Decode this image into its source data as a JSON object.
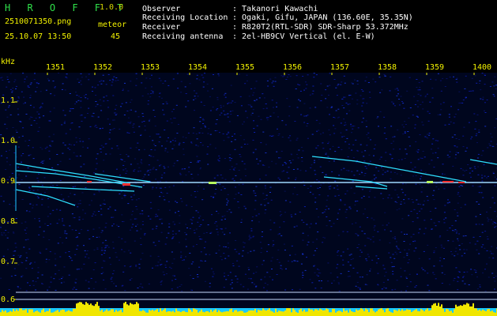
{
  "header": {
    "app_name": "H R O F F T",
    "app_version": "1.0.0",
    "filename": "2510071350.png",
    "datetime": "25.10.07 13:50",
    "mode_label": "meteor",
    "count": "45"
  },
  "info": {
    "observer": {
      "label": "Observer",
      "value": ": Takanori Kawachi"
    },
    "location": {
      "label": "Receiving Location",
      "value": ": Ogaki, Gifu, JAPAN (136.60E, 35.35N)"
    },
    "receiver": {
      "label": "Receiver",
      "value": ": R820T2(RTL-SDR) SDR-Sharp 53.372MHz"
    },
    "antenna": {
      "label": "Receiving antenna",
      "value": ": 2el-HB9CV Vertical (el. E-W)"
    }
  },
  "axis": {
    "y_unit": "kHz",
    "y_ticks": [
      "1.1",
      "1.0",
      "0.9",
      "0.8",
      "0.7",
      "0.6"
    ],
    "x_ticks": [
      "1351",
      "1352",
      "1353",
      "1354",
      "1355",
      "1356",
      "1357",
      "1358",
      "1359",
      "1400"
    ]
  },
  "colors": {
    "background": "#000000",
    "noise": "#0a1a9a",
    "carrier": "#8fd0ff",
    "meteor": "#2ee0ff",
    "head": "#ff3030",
    "bottom_bar": "#f0e600",
    "bottom_base": "#18c8ff"
  }
}
